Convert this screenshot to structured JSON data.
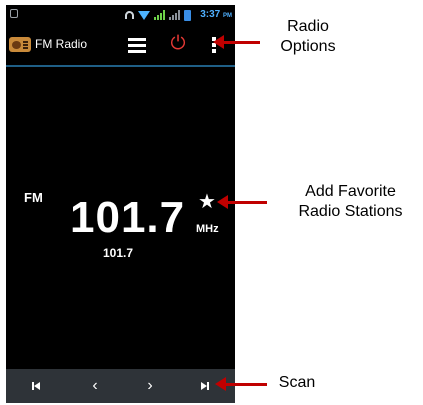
{
  "status_bar": {
    "time": "3:37",
    "ampm": "PM",
    "icons": [
      "screenshot-icon",
      "headset-icon",
      "wifi-icon",
      "signal-icon",
      "signal-icon",
      "battery-icon"
    ]
  },
  "app_bar": {
    "title": "FM Radio",
    "icons": [
      "radio-app-icon",
      "station-list-icon",
      "power-icon",
      "more-options-icon"
    ]
  },
  "tuner": {
    "band": "FM",
    "frequency": "101.7",
    "unit": "MHz",
    "station_name": "101.7",
    "favorite_icon": "star-icon"
  },
  "controls": {
    "icons": [
      "skip-previous-icon",
      "chevron-left-icon",
      "chevron-right-icon",
      "skip-next-icon"
    ]
  },
  "callouts": {
    "options": "Radio\nOptions",
    "favorite": "Add Favorite\nRadio Stations",
    "scan": "Scan"
  },
  "colors": {
    "background": "#000000",
    "accent_blue": "#4fb0ff",
    "power_red": "#e53935",
    "arrow_red": "#c00000",
    "bottom_bar": "#2e3338"
  }
}
